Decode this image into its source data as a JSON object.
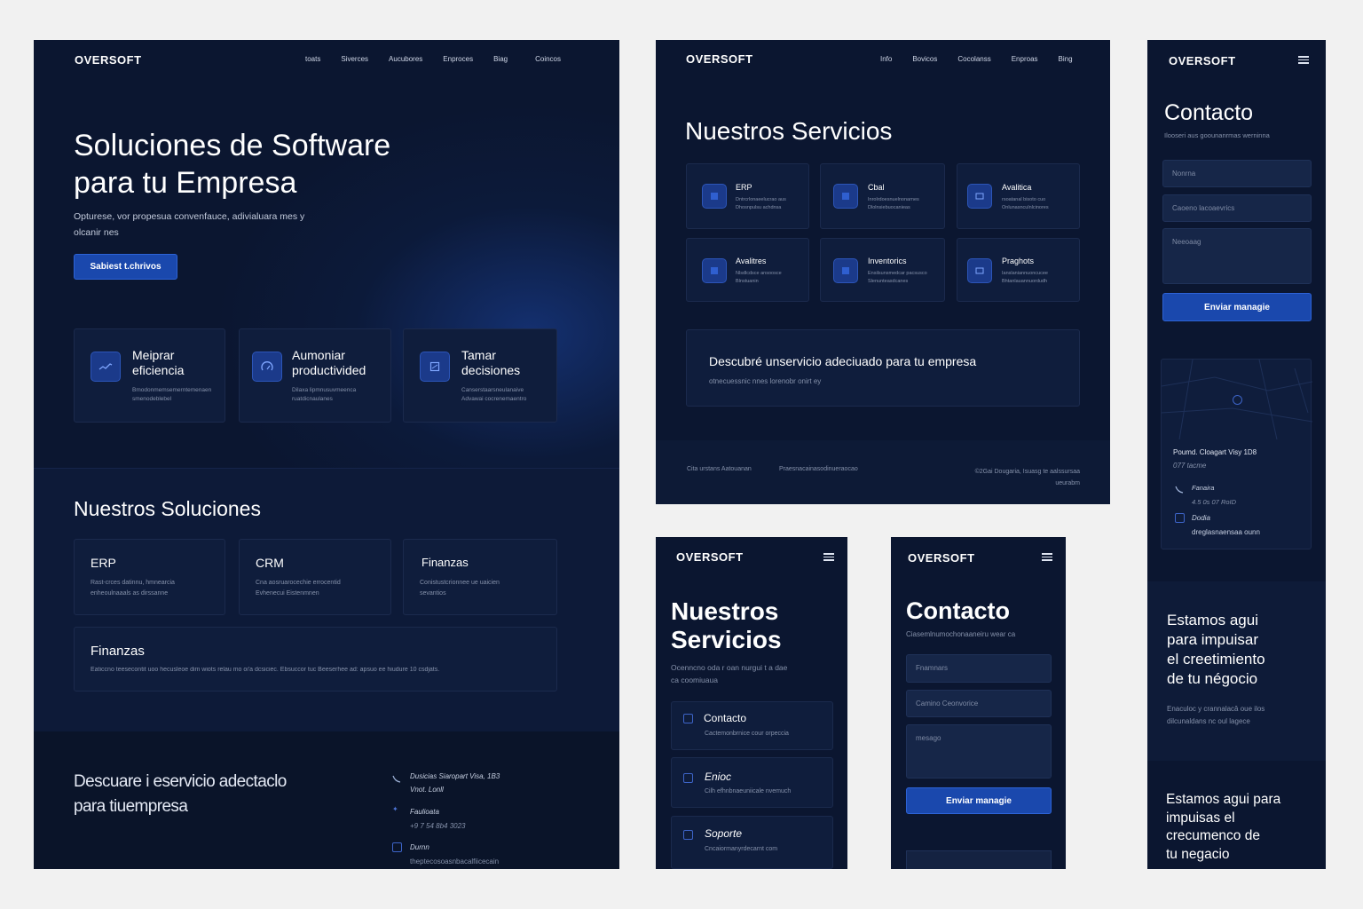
{
  "brand": "OVERSOFT",
  "colors": {
    "background": "#f1f1f1",
    "panel": "#0b1630",
    "card": "#0f1d3c",
    "accent": "#1a48ad",
    "text": "#e8ecf5"
  },
  "desktop_home": {
    "nav": [
      "toats",
      "Siverces",
      "Aucubores",
      "Enproces",
      "Biag",
      "Coincos"
    ],
    "hero": {
      "title_line1": "Soluciones de Software",
      "title_line2": "para tu Empresa",
      "subtitle_line1": "Opturese, vor propesua convenfauce, adivialuara mes y",
      "subtitle_line2": "olcanir nes",
      "cta": "Sabiest t.chrivos"
    },
    "benefits": [
      {
        "title_line1": "Meiprar",
        "title_line2": "eficiencia",
        "text_line1": "Bmodonmemsemerntemenaen",
        "text_line2": "smenodeblebel",
        "icon": "chart-icon"
      },
      {
        "title_line1": "Aumoniar",
        "title_line2": "productivided",
        "text_line1": "Dilaxa lipmnusuvmeenca",
        "text_line2": "ruatdicnaulanes",
        "icon": "gauge-icon"
      },
      {
        "title_line1": "Tamar",
        "title_line2": "decisiones",
        "text_line1": "Canserstaarsneulanaive",
        "text_line2": "Advawai cocrenemaentro",
        "icon": "document-icon"
      }
    ],
    "solutions_title": "Nuestros Soluciones",
    "solutions": [
      {
        "title": "ERP",
        "text_line1": "Rast-crces datinnu, hmnearcia",
        "text_line2": "enheoulnaaals as dirssanne"
      },
      {
        "title": "CRM",
        "text_line1": "Cna aosruarocechie errocentid",
        "text_line2": "Evhenecui Eistenmnen"
      },
      {
        "title": "Finanzas",
        "text_line1": "Conistustcrionnee ue uaicien",
        "text_line2": "sevantios"
      }
    ],
    "wide_solution": {
      "title": "Finanzas",
      "text": "Eaticcno teesecontit uoo hecusleoe dim wiots relau mo oi'a dcsiciec. Ebsuccor tuc Beeserhee ad: apsuo ee hiudure 10 csdjats."
    },
    "footer": {
      "cta_line1": "Descuare i eservicio adectaclo",
      "cta_line2": "para tiuempresa",
      "address_line1": "Dusicias Siaropart Visa, 1B3",
      "address_line2": "Vnot. Lonll",
      "phone_label": "Faulioata",
      "phone": "+9 7 54 8b4 3023",
      "email_label": "Durnn",
      "email": "theptecosoasnbacalfiicecain"
    }
  },
  "services_desktop": {
    "nav": [
      "Info",
      "Bovicos",
      "Cocolanss",
      "Enproas",
      "Bing"
    ],
    "title": "Nuestros Servicios",
    "services": [
      {
        "title": "ERP",
        "text_line1": "Dntrcrlonaeelucrao aus",
        "text_line2": "Dhosnpulsu achdnsa"
      },
      {
        "title": "Cbal",
        "text_line1": "Inrolrdoesnuelnonarnes",
        "text_line2": "Dlolnsiebuocanieas"
      },
      {
        "title": "Avalitica",
        "text_line1": "rsoatanal bisoto cuo",
        "text_line2": "Onlunasnculnlcinores"
      },
      {
        "title": "Avalitres",
        "text_line1": "Nlsdlcdsce ansoosce",
        "text_line2": "Blnstuanin"
      },
      {
        "title": "Inventorics",
        "text_line1": "Ensilsunsmedcar pacsusco",
        "text_line2": "Slenunteasdcanes"
      },
      {
        "title": "Praghots",
        "text_line1": "Ianslaniannuoncucee",
        "text_line2": "Bhtanlauannuordudh"
      }
    ],
    "banner_title": "Descubré unservicio adeciuado para tu  empresa",
    "banner_text": "otnecuessnic nnes lorenobr onirt ey",
    "footer_left1": "Cita urstans Aatouanan",
    "footer_left2": "Praesnacainasodinueraocao",
    "footer_right_line1": "©2Gai Dougaria, Isuasg te aalssursaa",
    "footer_right_line2": "ueurabm"
  },
  "mobile_services": {
    "title_line1": "Nuestros",
    "title_line2": "Servicios",
    "subtitle_line1": "Ocenncno oda r oan nurgui t a dae",
    "subtitle_line2": "ca coomiuaua",
    "items": [
      {
        "title": "Contacto",
        "text": "Cactemonbrnice cour orpeccia"
      },
      {
        "title": "Enioc",
        "text": "Cilh efhnbnaeuniicale nvemuch"
      },
      {
        "title": "Soporte",
        "text": "Cncaiormanyrdecarnt com"
      }
    ]
  },
  "mobile_contact": {
    "title": "Contacto",
    "subtitle": "Ciasemlnumochonaaneiru wear ca",
    "name_placeholder": "Fnamnars",
    "email_placeholder": "Camino Ceonvorice",
    "message_placeholder": "mesago",
    "submit": "Enviar managie"
  },
  "tall_contact": {
    "title": "Contacto",
    "subtitle": "Ilooseri aus goounanrmas werninna",
    "name_placeholder": "Nonrna",
    "email_placeholder": "Caoeno lacoaevrics",
    "message_placeholder": "Neeoaag",
    "submit": "Enviar managie",
    "address_line1": "Poumd. Cloagart Visy 1D8",
    "address_line2": "077 tacme",
    "phone_label": "Fanaira",
    "phone": "4.5 0s 07 RoID",
    "email_label": "Dodia",
    "email": "dreglasnaensaa ounn",
    "slogan1_line1": "Estamos agui",
    "slogan1_line2": "para impuisar",
    "slogan1_line3": "el creetimiento",
    "slogan1_line4": "de tu négocio",
    "slogan1_sub_line1": "Enaculoc y crannalacâ oue ilos",
    "slogan1_sub_line2": "dilcunaldans nc oul lagece",
    "slogan2_line1": "Estamos agui para",
    "slogan2_line2": "impuisas el",
    "slogan2_line3": "crecumenco de",
    "slogan2_line4": "tu negacio"
  }
}
